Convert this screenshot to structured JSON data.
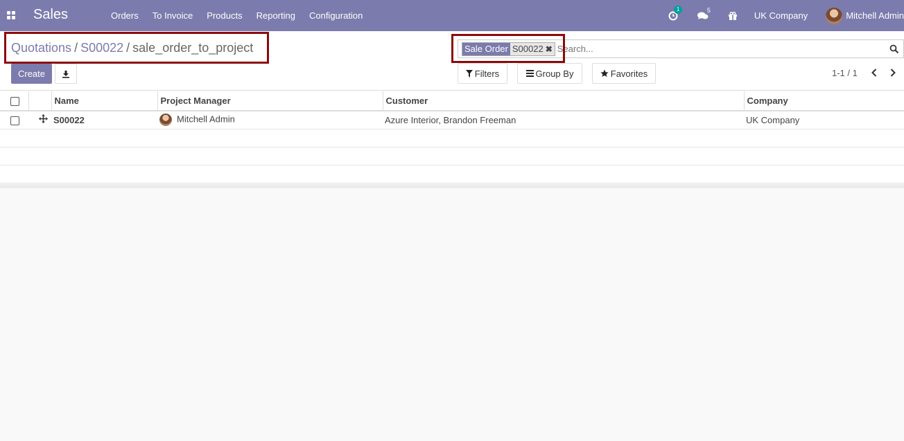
{
  "navbar": {
    "brand": "Sales",
    "menu": [
      "Orders",
      "To Invoice",
      "Products",
      "Reporting",
      "Configuration"
    ],
    "activity_badge": "1",
    "messages_count": "5",
    "company": "UK Company",
    "user": "Mitchell Admin"
  },
  "breadcrumb": {
    "items": [
      "Quotations",
      "S00022",
      "sale_order_to_project"
    ],
    "separator": "/"
  },
  "search": {
    "facet_label": "Sale Order",
    "facet_value": "S00022",
    "facet_remove": "✖",
    "placeholder": "Search..."
  },
  "toolbar": {
    "create_label": "Create",
    "filters_label": "Filters",
    "groupby_label": "Group By",
    "favorites_label": "Favorites",
    "pager": "1-1 / 1"
  },
  "table": {
    "columns": [
      "Name",
      "Project Manager",
      "Customer",
      "Company"
    ],
    "rows": [
      {
        "name": "S00022",
        "manager": "Mitchell Admin",
        "customer": "Azure Interior, Brandon Freeman",
        "company": "UK Company"
      }
    ]
  },
  "colors": {
    "brand": "#7c7bad",
    "highlight": "#8b0a0a"
  }
}
